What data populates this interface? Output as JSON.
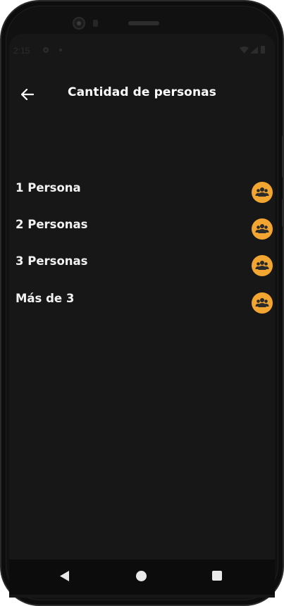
{
  "status_bar": {
    "time": "2:15"
  },
  "app_bar": {
    "title": "Cantidad de personas",
    "back_icon": "arrow-left-icon"
  },
  "options": [
    {
      "label": "1 Persona",
      "icon": "group-icon"
    },
    {
      "label": "2 Personas",
      "icon": "group-icon"
    },
    {
      "label": "3 Personas",
      "icon": "group-icon"
    },
    {
      "label": "Más de 3",
      "icon": "group-icon"
    }
  ],
  "colors": {
    "background": "#171717",
    "accent": "#f3a531",
    "text": "#ffffff"
  },
  "nav_bar": {
    "back_icon": "triangle-back-icon",
    "home_icon": "circle-home-icon",
    "recents_icon": "square-recents-icon"
  }
}
